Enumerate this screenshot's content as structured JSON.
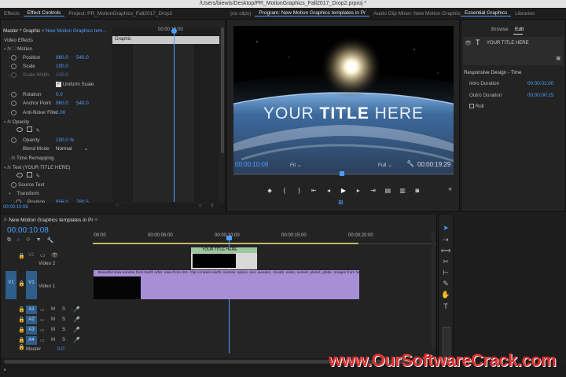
{
  "window": {
    "title": "/Users/biewis/Desktop/PR_MotionGraphics_Fall2017_Drop2.prproj *"
  },
  "left_tabs": [
    "Effects",
    "Effect Controls",
    "Project: PR_MotionGraphics_Fall2017_Drop2"
  ],
  "effect_controls": {
    "source": "Master * Graphic",
    "clip": "New Motion Graphics tem...",
    "header_time": "00:00:10:00",
    "graphic_label": "Graphic",
    "video_effects": "Video Effects",
    "motion": "Motion",
    "position_label": "Position",
    "position_x": "960.0",
    "position_y": "540.0",
    "scale_label": "Scale",
    "scale_value": "100.0",
    "scale_width_label": "Scale Width",
    "scale_width_value": "100.0",
    "uniform_scale": "Uniform Scale",
    "rotation_label": "Rotation",
    "rotation_value": "0.0",
    "anchor_label": "Anchor Point",
    "anchor_x": "960.0",
    "anchor_y": "540.0",
    "flicker_label": "Anti-flicker Filter",
    "flicker_value": "1.00",
    "opacity": "Opacity",
    "opacity_label": "Opacity",
    "opacity_value": "100.0 %",
    "blend_label": "Blend Mode",
    "blend_value": "Normal",
    "time_remap": "Time Remapping",
    "text_layer": "Text (YOUR TITLE HERE)",
    "source_text": "Source Text",
    "transform": "Transform",
    "position2_label": "Position",
    "position2_x": "956.0",
    "position2_y": "780.5",
    "footer_time": "00:00:10:08"
  },
  "center_tabs": [
    "(no clips)",
    "Program: New Motion Graphics templates in Pr",
    "Audio Clip Mixer: New Motion Graphics"
  ],
  "program": {
    "title_light": "YOUR ",
    "title_bold": "TITLE",
    "title_end": " HERE",
    "timecode": "00:00:10:08",
    "fit": "Fit",
    "quality": "Full",
    "duration": "00:00:19:29"
  },
  "essential": {
    "tab": "Essential Graphics",
    "tab2": "Libraries",
    "browse": "Browse",
    "edit": "Edit",
    "layer_name": "YOUR TITLE HERE",
    "responsive": "Responsive Design - Time",
    "intro_label": "Intro Duration",
    "intro_value": "00:00:01:00",
    "outro_label": "Outro Duration",
    "outro_value": "00:00:00:15",
    "roll": "Roll"
  },
  "timeline": {
    "tab": "New Motion Graphics templates in Pr",
    "timecode": "00:00:10:08",
    "ruler": [
      ":00:00",
      "00:00:05:00",
      "00:00:10:00",
      "00:00:15:00",
      "00:00:20:00"
    ],
    "tracks": [
      {
        "id": "V2",
        "name": "Video 2"
      },
      {
        "id": "V1",
        "name": "Video 1"
      },
      {
        "id": "A1",
        "name": ""
      },
      {
        "id": "A2",
        "name": ""
      },
      {
        "id": "A3",
        "name": ""
      },
      {
        "id": "A4",
        "name": ""
      }
    ],
    "master_label": "Master",
    "master_value": "0.0",
    "title_clip": "YOUR TITLE HERE",
    "main_clip": "Beautiful slow sunrise from Earth orbit. View from ISS. Clip contains earth, sunrise, space, sun, awaken, clouds, water, sunset, planet, globe. Images from NASA.m",
    "v1_left": "V1",
    "mute": "M",
    "solo": "S"
  },
  "watermark": "www.OurSoftwareCrack.com",
  "colors": {
    "accent": "#4d9cff",
    "clip": "#a78fd6",
    "watermark": "#e03030"
  }
}
